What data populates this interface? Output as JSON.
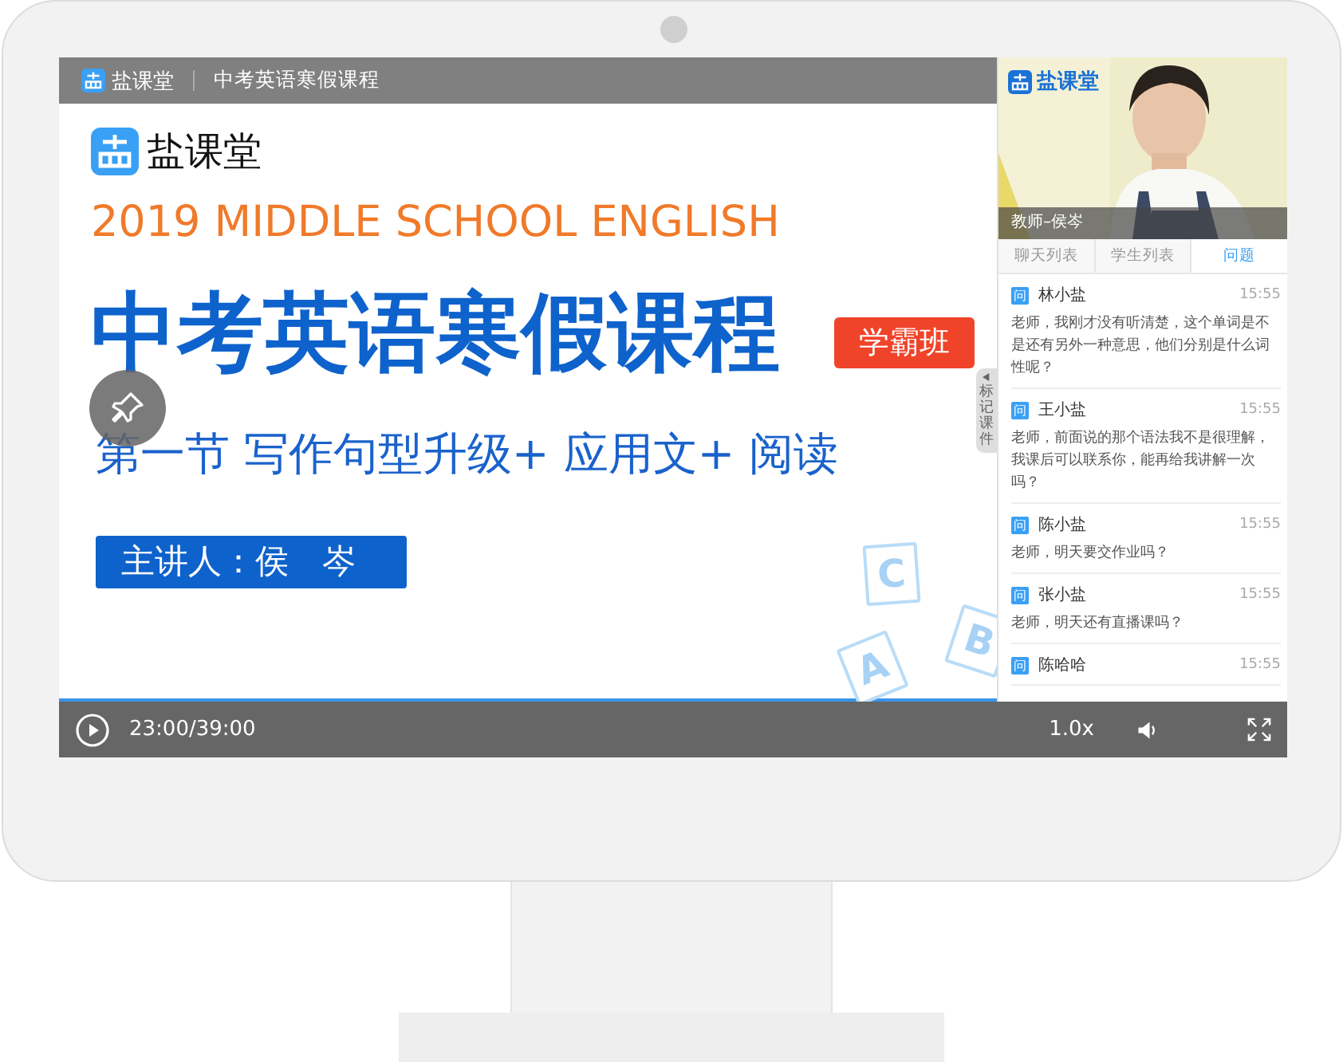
{
  "top_bar": {
    "brand": "盐课堂",
    "title": "中考英语寒假课程"
  },
  "slide": {
    "brand": "盐课堂",
    "subtitle_en": "2019 MIDDLE SCHOOL ENGLISH",
    "title": "中考英语寒假课程",
    "badge": "学霸班",
    "lesson": "第一节 写作句型升级+ 应用文+ 阅读",
    "speaker": "主讲人：侯　岑",
    "blocks": [
      "C",
      "B",
      "A"
    ]
  },
  "mark_tab": "标记课件",
  "camera": {
    "brand": "盐课堂",
    "caption": "教师–侯岑"
  },
  "tabs": [
    {
      "label": "聊天列表",
      "selected": false
    },
    {
      "label": "学生列表",
      "selected": false
    },
    {
      "label": "问题",
      "selected": true
    }
  ],
  "questions": [
    {
      "tag": "问",
      "name": "林小盐",
      "time": "15:55",
      "text": "老师，我刚才没有听清楚，这个单词是不是还有另外一种意思，他们分别是什么词性呢？"
    },
    {
      "tag": "问",
      "name": "王小盐",
      "time": "15:55",
      "text": "老师，前面说的那个语法我不是很理解，我课后可以联系你，能再给我讲解一次吗？"
    },
    {
      "tag": "问",
      "name": "陈小盐",
      "time": "15:55",
      "text": "老师，明天要交作业吗？"
    },
    {
      "tag": "问",
      "name": "张小盐",
      "time": "15:55",
      "text": "老师，明天还有直播课吗？"
    },
    {
      "tag": "问",
      "name": "陈哈哈",
      "time": "15:55"
    }
  ],
  "player": {
    "time": "23:00/39:00",
    "speed": "1.0x"
  }
}
